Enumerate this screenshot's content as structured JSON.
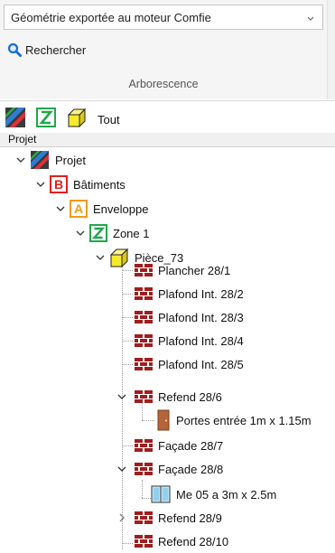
{
  "filter": {
    "value": "Géométrie exportée au moteur Comfie"
  },
  "search": {
    "label": "Rechercher"
  },
  "section": {
    "title": "Arborescence"
  },
  "toolbar": {
    "all_label": "Tout"
  },
  "tree_header": {
    "label": "Projet"
  },
  "tree": {
    "projet": "Projet",
    "batiments": "Bâtiments",
    "enveloppe": "Enveloppe",
    "zone": "Zone 1",
    "piece": "Pièce_73",
    "items": [
      "Plancher 28/1",
      "Plafond Int. 28/2",
      "Plafond Int. 28/3",
      "Plafond Int. 28/4",
      "Plafond Int. 28/5",
      "Refend 28/6",
      "Portes entrée 1m x 1.15m",
      "Façade 28/7",
      "Façade 28/8",
      "Me 05 a 3m x 2.5m",
      "Refend 28/9",
      "Refend 28/10"
    ]
  },
  "colors": {
    "brick": "#a01e1e",
    "zone_green": "#1fa84a",
    "batiment_red": "#e02020",
    "enveloppe_orange": "#f39a1b",
    "cube_yellow": "#f6ea2c",
    "link_blue": "#1a6fd1"
  }
}
